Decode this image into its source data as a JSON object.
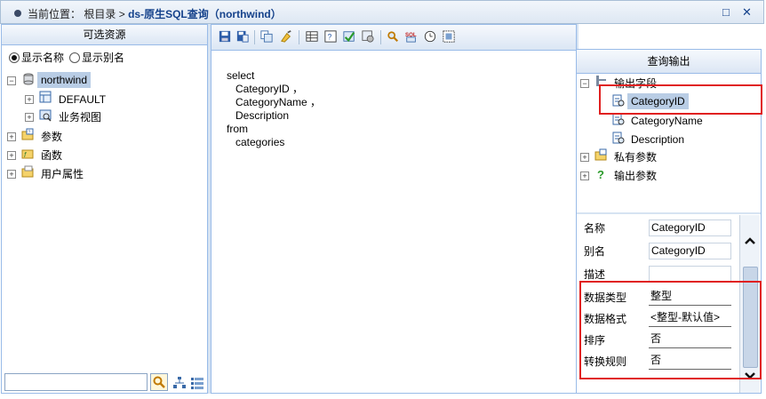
{
  "title": {
    "location_label": "当前位置：",
    "root": "根目录",
    "sep": ">",
    "current": "ds-原生SQL查询（northwind）",
    "maximize_glyph": "□",
    "close_glyph": "✕"
  },
  "left": {
    "header": "可选资源",
    "radio_show_name": "显示名称",
    "radio_show_alias": "显示别名",
    "tree": {
      "root": "northwind",
      "children": [
        "DEFAULT",
        "业务视图"
      ],
      "siblings": [
        "参数",
        "函数",
        "用户属性"
      ]
    },
    "search": {
      "value": "",
      "placeholder": ""
    }
  },
  "editor": {
    "sql": "select\n   CategoryID ，\n   CategoryName ，\n   Description\nfrom\n   categories"
  },
  "right": {
    "header": "查询输出",
    "tree": {
      "output_fields": "输出字段",
      "fields": [
        "CategoryID",
        "CategoryName",
        "Description"
      ],
      "private_params": "私有参数",
      "output_params": "输出参数"
    },
    "props": [
      {
        "label": "名称",
        "value": "CategoryID"
      },
      {
        "label": "别名",
        "value": "CategoryID"
      },
      {
        "label": "描述",
        "value": ""
      },
      {
        "label": "数据类型",
        "value": "整型"
      },
      {
        "label": "数据格式",
        "value": "<整型-默认值>"
      },
      {
        "label": "排序",
        "value": "否"
      },
      {
        "label": "转换规则",
        "value": "否"
      }
    ]
  },
  "colors": {
    "accent": "#15428b",
    "border": "#99bbe8",
    "highlight": "#e02020",
    "selected": "#b9cde5"
  }
}
